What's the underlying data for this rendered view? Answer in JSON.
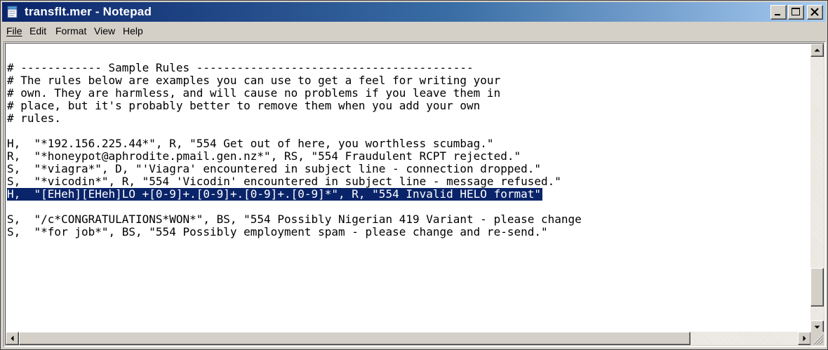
{
  "window": {
    "title": "transflt.mer - Notepad",
    "title_icon": "notepad-icon"
  },
  "menu": {
    "file": "File",
    "edit": "Edit",
    "format": "Format",
    "view": "View",
    "help": "Help"
  },
  "editor": {
    "lines": [
      "",
      "# ------------ Sample Rules -----------------------------------------",
      "# The rules below are examples you can use to get a feel for writing your",
      "# own. They are harmless, and will cause no problems if you leave them in",
      "# place, but it's probably better to remove them when you add your own",
      "# rules.",
      "",
      "H,  \"*192.156.225.44*\", R, \"554 Get out of here, you worthless scumbag.\"",
      "R,  \"*honeypot@aphrodite.pmail.gen.nz*\", RS, \"554 Fraudulent RCPT rejected.\"",
      "S,  \"*viagra*\", D, \"'Viagra' encountered in subject line - connection dropped.\"",
      "S,  \"*vicodin*\", R, \"554 'Vicodin' encountered in subject line - message refused.\"",
      "H,  \"[EHeh][EHeh]LO +[0-9]+.[0-9]+.[0-9]+.[0-9]*\", R, \"554 Invalid HELO format\"",
      "",
      "S,  \"/c*CONGRATULATIONS*WON*\", BS, \"554 Possibly Nigerian 419 Variant - please change",
      "S,  \"*for job*\", BS, \"554 Possibly employment spam - please change and re-send.\""
    ],
    "selected_line_index": 11
  },
  "colors": {
    "selection": "#0a246a",
    "titlebar_start": "#0a246a",
    "titlebar_end": "#a6caf0"
  }
}
